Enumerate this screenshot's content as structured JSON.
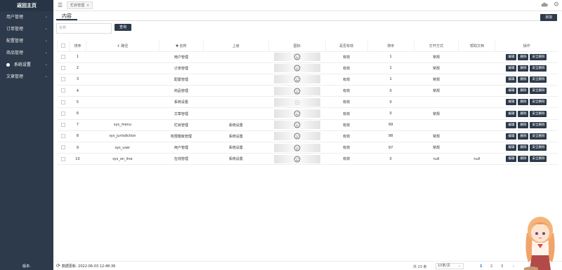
{
  "sidebar": {
    "home": "返回主页",
    "items": [
      {
        "label": "用户管理"
      },
      {
        "label": "订单管理"
      },
      {
        "label": "配置管理"
      },
      {
        "label": "商品管理"
      },
      {
        "label": "系统设置"
      },
      {
        "label": "文章管理"
      }
    ],
    "version": "版本:"
  },
  "topbar": {
    "tab_label": "栏目管理",
    "tab_close": "×"
  },
  "content_tab": "内容",
  "add_button": "添加",
  "search": {
    "placeholder": "名称",
    "button": "查询"
  },
  "table": {
    "headers": [
      "",
      "排序",
      "路径",
      "名称",
      "上级",
      "图标",
      "是否有效",
      "排序",
      "打开方式",
      "帮助文档",
      "操作"
    ],
    "rows": [
      {
        "idx": "1",
        "path": "",
        "name": "用户管理",
        "parent": "",
        "icon": "frown",
        "valid": "有效",
        "sort": "1",
        "open": "常规",
        "help": ""
      },
      {
        "idx": "2",
        "path": "",
        "name": "订单管理",
        "parent": "",
        "icon": "frown",
        "valid": "有效",
        "sort": "1",
        "open": "常规",
        "help": ""
      },
      {
        "idx": "3",
        "path": "",
        "name": "配置管理",
        "parent": "",
        "icon": "frown",
        "valid": "有效",
        "sort": "1",
        "open": "常规",
        "help": ""
      },
      {
        "idx": "4",
        "path": "",
        "name": "商品管理",
        "parent": "",
        "icon": "frown",
        "valid": "有效",
        "sort": "0",
        "open": "常规",
        "help": ""
      },
      {
        "idx": "5",
        "path": "",
        "name": "系统设置",
        "parent": "",
        "icon": "gear",
        "valid": "有效",
        "sort": "0",
        "open": "",
        "help": ""
      },
      {
        "idx": "6",
        "path": "",
        "name": "文章管理",
        "parent": "",
        "icon": "frown",
        "valid": "有效",
        "sort": "0",
        "open": "常规",
        "help": ""
      },
      {
        "idx": "7",
        "path": "sys_menu",
        "name": "栏目管理",
        "parent": "系统设置",
        "icon": "frown",
        "valid": "有效",
        "sort": "99",
        "open": "",
        "help": ""
      },
      {
        "idx": "8",
        "path": "sys_jurisdiction",
        "name": "权限模板管理",
        "parent": "系统设置",
        "icon": "frown",
        "valid": "有效",
        "sort": "98",
        "open": "常规",
        "help": ""
      },
      {
        "idx": "9",
        "path": "sys_user",
        "name": "用户管理",
        "parent": "系统设置",
        "icon": "frown",
        "valid": "有效",
        "sort": "97",
        "open": "常规",
        "help": ""
      },
      {
        "idx": "10",
        "path": "sys_on_line",
        "name": "在线管理",
        "parent": "系统设置",
        "icon": "frown",
        "valid": "有效",
        "sort": "0",
        "open": "null",
        "help": "null"
      }
    ],
    "actions": {
      "edit": "编辑",
      "delete": "删除",
      "safe_delete": "安全删除"
    }
  },
  "footer": {
    "refresh_text": "数据更新: 2022-06-03 12:48:36",
    "total": "共 23 条",
    "page_size": "10条/页",
    "prev": "‹",
    "pages": [
      "1",
      "2",
      "3"
    ],
    "next": "›",
    "current_page": "1"
  },
  "colors": {
    "sidebar": "#2d3a4b",
    "accent": "#1e6fd9"
  }
}
